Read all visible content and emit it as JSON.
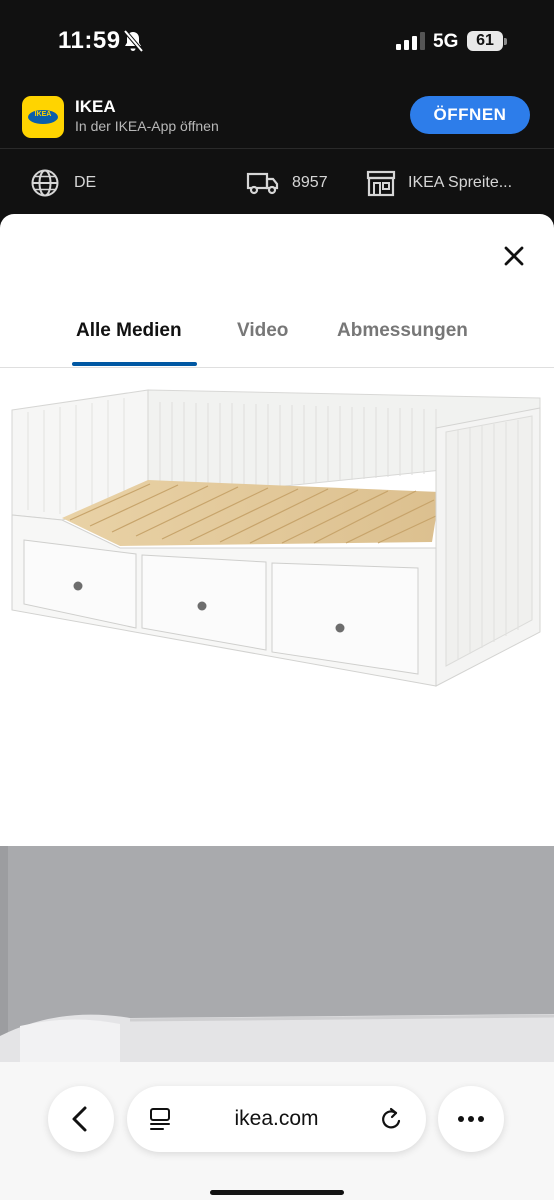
{
  "status_bar": {
    "time": "11:59",
    "network": "5G",
    "battery": "61",
    "icons": [
      "bell-off-icon",
      "signal-icon",
      "battery-icon"
    ]
  },
  "app_banner": {
    "app_name": "IKEA",
    "subtitle": "In der IKEA-App öffnen",
    "open_button": "ÖFFNEN",
    "logo_text": "IKEA",
    "accent_color": "#2d7dea"
  },
  "header": {
    "language": "DE",
    "zip_code": "8957",
    "store": "IKEA Spreite..."
  },
  "media_viewer": {
    "tabs": [
      {
        "label": "Alle Medien",
        "active": true
      },
      {
        "label": "Video",
        "active": false
      },
      {
        "label": "Abmessungen",
        "active": false
      }
    ],
    "underline_color": "#0058a3",
    "images": [
      "daybed-white-three-drawers",
      "daybed-lifestyle-grey-wall"
    ]
  },
  "browser": {
    "url": "ikea.com",
    "icons": [
      "back-icon",
      "tabs-icon",
      "reload-icon",
      "more-icon"
    ]
  }
}
